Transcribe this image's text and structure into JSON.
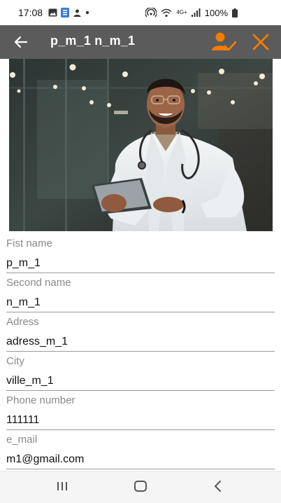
{
  "status_bar": {
    "time": "17:08",
    "battery": "100%",
    "network": "4G+"
  },
  "app_bar": {
    "title": "p_m_1 n_m_1",
    "accent_color": "#f57c00",
    "background": "#5b5b5b"
  },
  "photo": {
    "description_icon": "doctor-photo"
  },
  "fields": [
    {
      "label": "Fist name",
      "value": "p_m_1"
    },
    {
      "label": "Second name",
      "value": "n_m_1"
    },
    {
      "label": "Adress",
      "value": "adress_m_1"
    },
    {
      "label": "City",
      "value": "ville_m_1"
    },
    {
      "label": "Phone number",
      "value": "111111"
    },
    {
      "label": "e_mail",
      "value": "m1@gmail.com"
    }
  ],
  "nav_bar": {
    "recent_icon": "recent-apps-icon",
    "home_icon": "home-icon",
    "back_icon": "back-nav-icon"
  }
}
